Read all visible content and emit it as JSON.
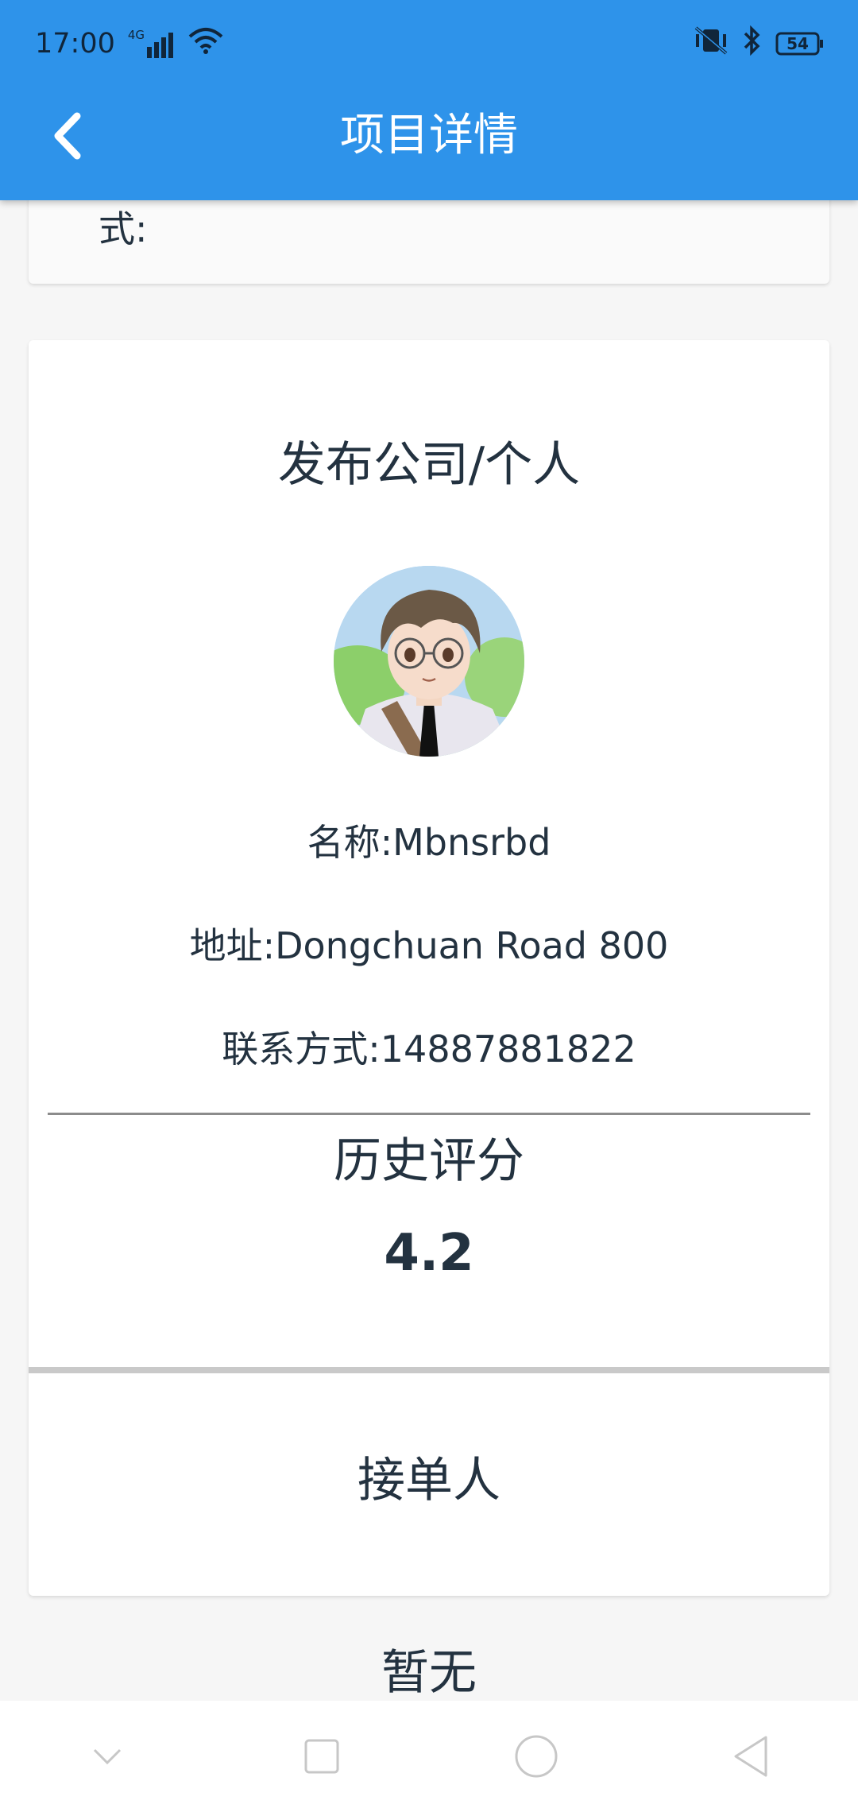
{
  "status_bar": {
    "time": "17:00",
    "network": "4G",
    "battery": "54"
  },
  "app_bar": {
    "title": "项目详情"
  },
  "top_card": {
    "partial_text": "式:"
  },
  "publisher": {
    "section_title": "发布公司/个人",
    "name_line": "名称:Mbnsrbd",
    "address_line": "地址:Dongchuan Road 800",
    "contact_line": "联系方式:14887881822"
  },
  "rating": {
    "title": "历史评分",
    "value": "4.2"
  },
  "receiver": {
    "section_title": "接单人",
    "value": "暂无"
  },
  "colors": {
    "primary": "#2e93ea",
    "text": "#233240"
  }
}
